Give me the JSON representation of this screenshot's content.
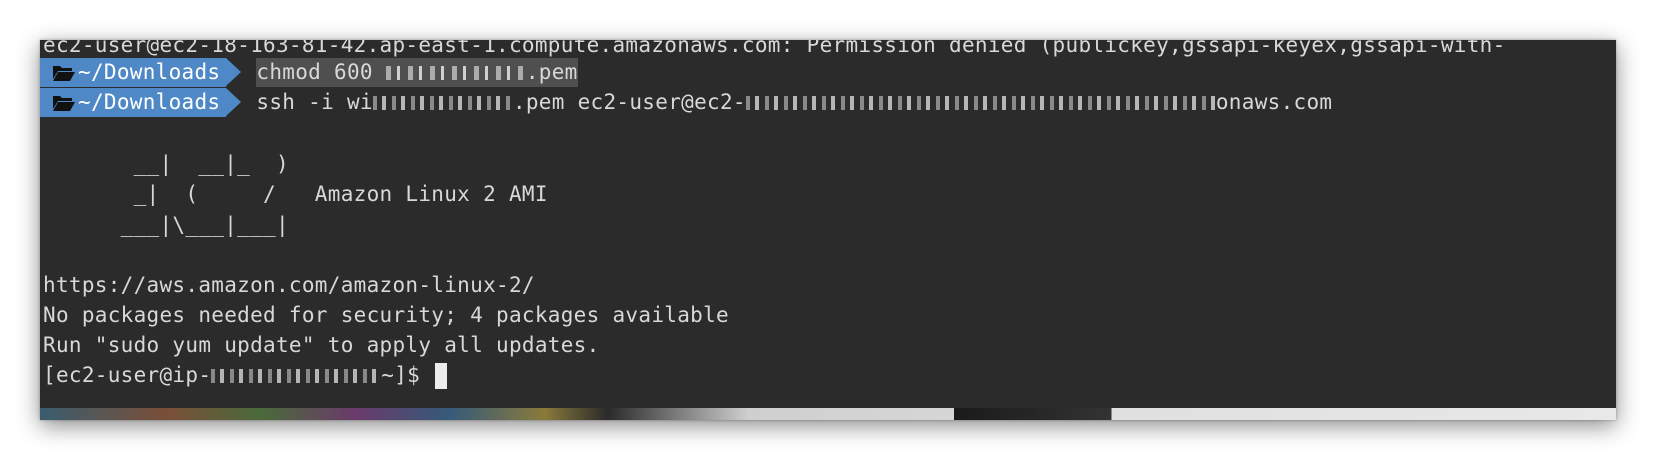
{
  "terminal": {
    "top_cut_line": "ec2-user@ec2-18-163-81-42.ap-east-1.compute.amazonaws.com: Permission denied (publickey,gssapi-keyex,gssapi-with-",
    "prompts": [
      {
        "dir": "~/Downloads",
        "command_prefix": "chmod 600 ",
        "command_suffix": ".pem"
      },
      {
        "dir": "~/Downloads",
        "command_prefix": "ssh -i wi",
        "command_middle": ".pem ec2-user@ec2-",
        "command_suffix": "onaws.com"
      }
    ],
    "motd": {
      "art_line_1": "       __|  __|_  )",
      "art_line_2": "       _|  (     /   Amazon Linux 2 AMI",
      "art_line_3": "      ___|\\___|___|",
      "url": "https://aws.amazon.com/amazon-linux-2/",
      "packages": "No packages needed for security; 4 packages available",
      "update_hint": "Run \"sudo yum update\" to apply all updates."
    },
    "shell_prompt_prefix": "[ec2-user@ip-",
    "shell_prompt_suffix": "~]$ "
  },
  "icons": {
    "folder": "folder-open-icon"
  },
  "colors": {
    "background": "#2b2b2b",
    "prompt_segment": "#4e88c7",
    "text": "#d8d8d8"
  }
}
